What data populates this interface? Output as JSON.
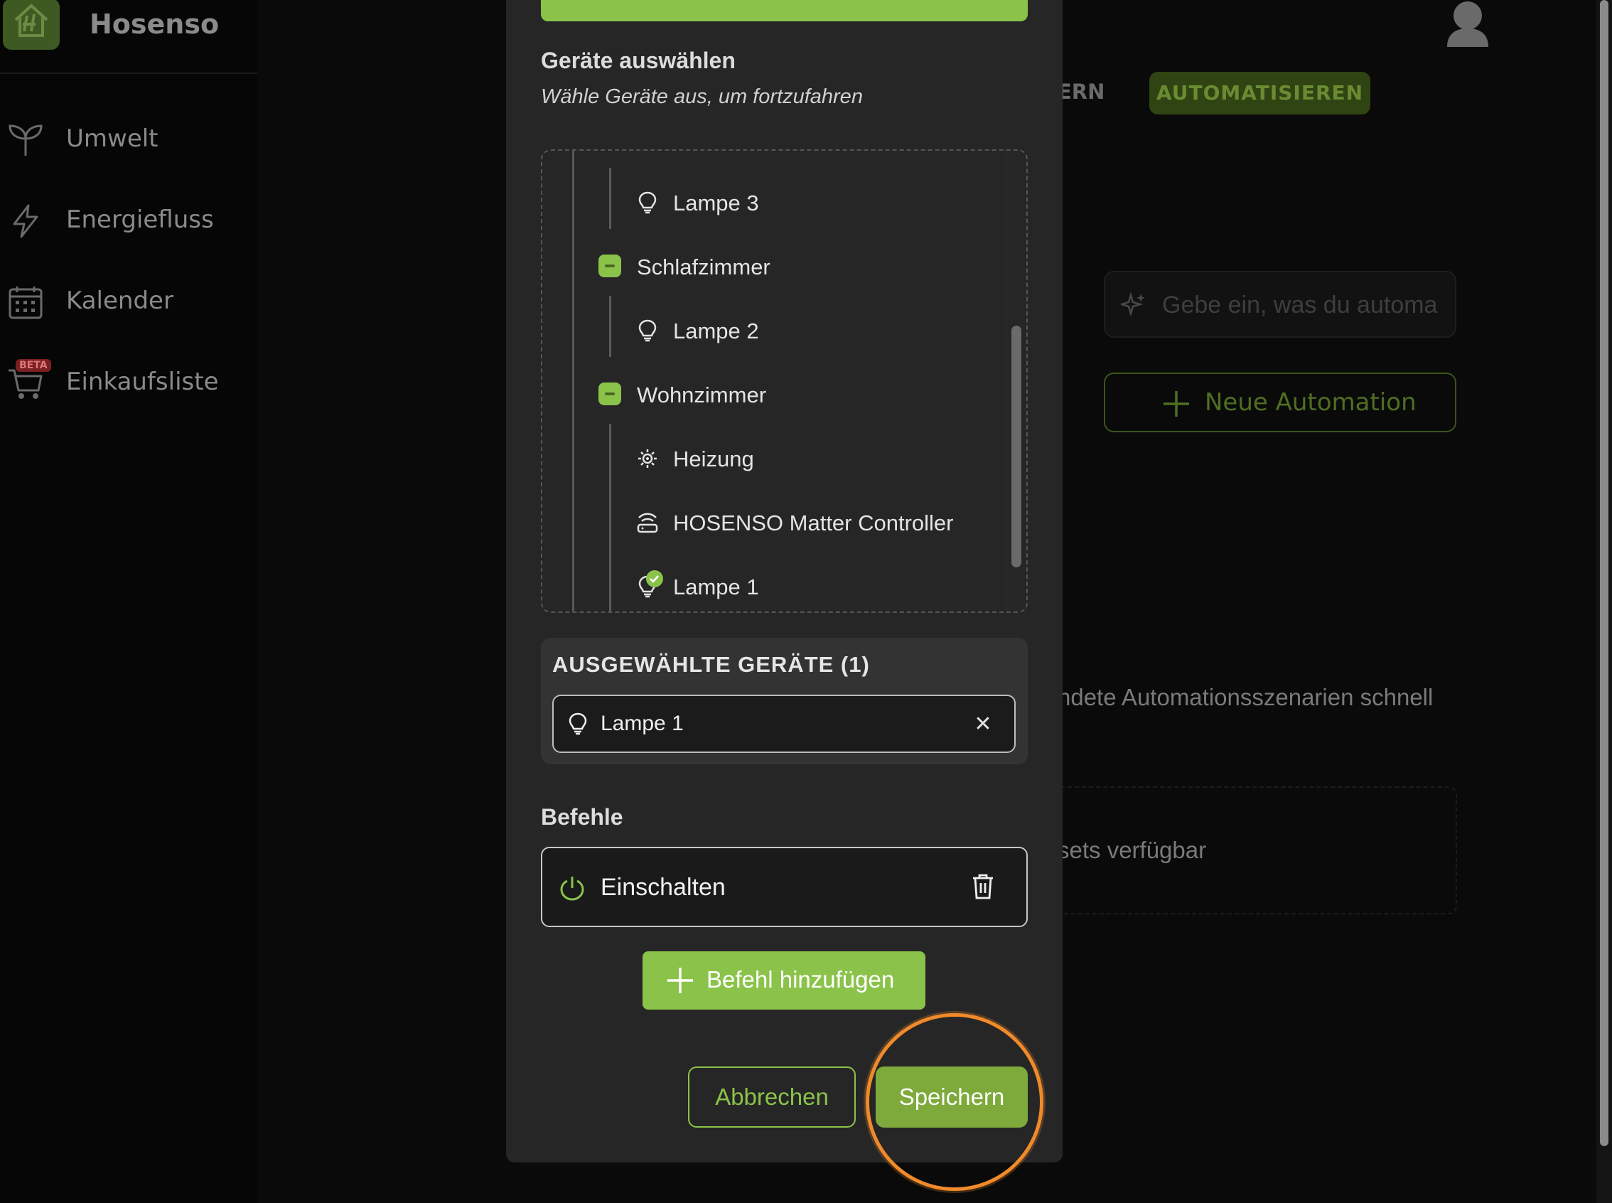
{
  "app": {
    "brand": "Hosenso",
    "nav": [
      {
        "label": "Umwelt",
        "icon": "sprout-icon"
      },
      {
        "label": "Energiefluss",
        "icon": "lightning-icon"
      },
      {
        "label": "Kalender",
        "icon": "calendar-icon"
      },
      {
        "label": "Einkaufsliste",
        "icon": "cart-icon",
        "badge": "BETA"
      }
    ],
    "tabs": {
      "partial_left": "ERN",
      "active": "AUTOMATISIEREN"
    },
    "ai_input_placeholder": "Gebe ein, was du automa",
    "new_automation": "Neue Automation",
    "bg_text_presets": "ndete Automationsszenarien schnell",
    "bg_text_none": "sets verfügbar"
  },
  "modal": {
    "title": "Geräte auswählen",
    "subtitle": "Wähle Geräte aus, um fortzufahren",
    "tree": [
      {
        "type": "device",
        "label": "Lampe 3",
        "icon": "bulb-icon"
      },
      {
        "type": "room",
        "label": "Schlafzimmer"
      },
      {
        "type": "device",
        "label": "Lampe 2",
        "icon": "bulb-icon"
      },
      {
        "type": "room",
        "label": "Wohnzimmer"
      },
      {
        "type": "device",
        "label": "Heizung",
        "icon": "heater-icon"
      },
      {
        "type": "device",
        "label": "HOSENSO Matter Controller",
        "icon": "router-icon"
      },
      {
        "type": "device",
        "label": "Lampe 1",
        "icon": "bulb-checked-icon",
        "selected": true
      }
    ],
    "selected_title": "AUSGEWÄHLTE GERÄTE (1)",
    "selected_devices": [
      {
        "label": "Lampe 1",
        "icon": "bulb-icon"
      }
    ],
    "commands_title": "Befehle",
    "commands": [
      {
        "label": "Einschalten",
        "icon": "power-icon"
      }
    ],
    "add_command": "Befehl hinzufügen",
    "cancel": "Abbrechen",
    "save": "Speichern"
  },
  "colors": {
    "accent": "#8bc34a",
    "modal_bg": "#262626",
    "highlight": "#f08a2a"
  }
}
